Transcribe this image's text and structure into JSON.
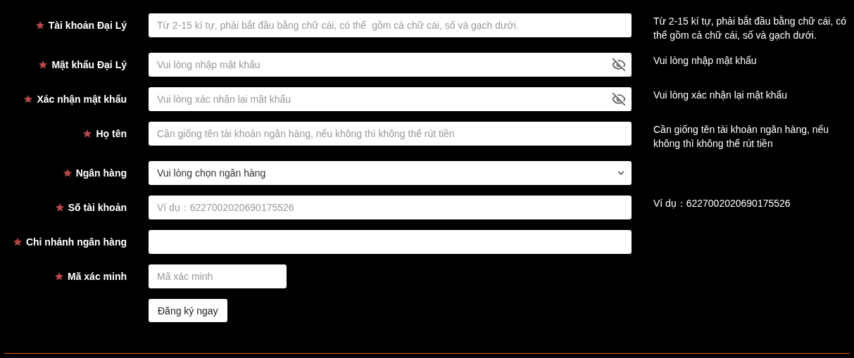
{
  "fields": [
    {
      "kind": "text",
      "label": "Tài khoản Đại Lý",
      "required": true,
      "placeholder": "Từ 2-15 kí tự, phải bắt đầu bằng chữ cái, có thể  gồm cả chữ cái, số và gạch dưới.",
      "hint": "Từ 2-15 kí tự, phải bắt đầu bằng chữ cái, có thể gồm cả chữ cái, số và gạch dưới."
    },
    {
      "kind": "password",
      "label": "Mật khẩu Đại Lý",
      "required": true,
      "placeholder": "Vui lòng nhập mật khẩu",
      "hint": "Vui lòng nhập mật khẩu"
    },
    {
      "kind": "password",
      "label": "Xác nhận mật khẩu",
      "required": true,
      "placeholder": "Vui lòng xác nhận lại mật khẩu",
      "hint": "Vui lòng xác nhận lại mật khẩu"
    },
    {
      "kind": "text",
      "label": "Họ tên",
      "required": true,
      "placeholder": "Cần giống tên tài khoản ngân hàng, nếu không thì không thể rút tiền",
      "hint": "Cần giống tên tài khoản ngân hàng, nếu không thì không thể rút tiền"
    },
    {
      "kind": "select",
      "label": "Ngân hàng",
      "required": true,
      "value": "Vui lòng chọn ngân hàng"
    },
    {
      "kind": "text",
      "label": "Số tài khoản",
      "required": true,
      "placeholder": "Ví dụ：6227002020690175526",
      "hint": "Ví dụ：6227002020690175526"
    },
    {
      "kind": "text",
      "label": "Chi nhánh ngân hàng",
      "required": true
    },
    {
      "kind": "short",
      "label": "Mã xác minh",
      "required": true,
      "placeholder": "Mã xác minh"
    }
  ],
  "submit": "Đăng ký ngay"
}
